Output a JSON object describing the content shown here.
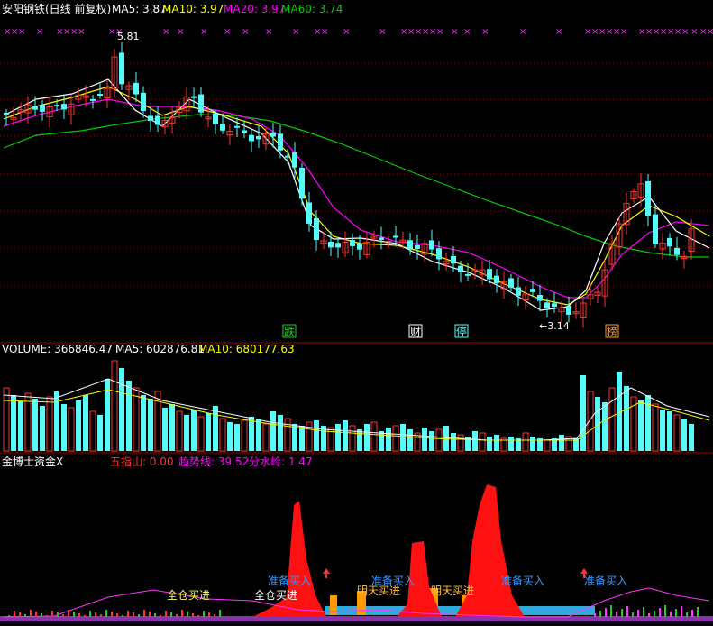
{
  "header": {
    "title": "安阳钢铁(日线 前复权)",
    "ma5_label": "MA5: 3.87",
    "ma10_label": "MA10: 3.97",
    "ma20_label": "MA20: 3.97",
    "ma60_label": "MA60: 3.74"
  },
  "price": {
    "peak_label": "5.81",
    "trough_label": "←3.14",
    "signals": [
      {
        "text": "跌",
        "color": "#22cc22"
      },
      {
        "text": "财",
        "color": "#ffffff"
      },
      {
        "text": "停",
        "color": "#54fcfc"
      },
      {
        "text": "榜",
        "color": "#ff9933"
      }
    ]
  },
  "volume": {
    "label": "VOLUME: 366846.47",
    "ma5": "MA5: 602876.81",
    "ma10": "MA10: 680177.63"
  },
  "indicator": {
    "name": "金博士资金X",
    "wuzhishan": "五指山: 0.00",
    "trend": "趋势线: 39.52",
    "watershed": "分水岭: 1.47",
    "annotations": {
      "full_buy": "全仓买进",
      "prepare_buy": "准备买入",
      "tomorrow_buy": "明天买进"
    }
  },
  "colors": {
    "up": "#ff3333",
    "down": "#54fcfc",
    "ma5": "#ffffff",
    "ma10": "#ffff00",
    "ma20": "#ff00ff",
    "ma60": "#00cc00",
    "grid": "#990000"
  }
}
